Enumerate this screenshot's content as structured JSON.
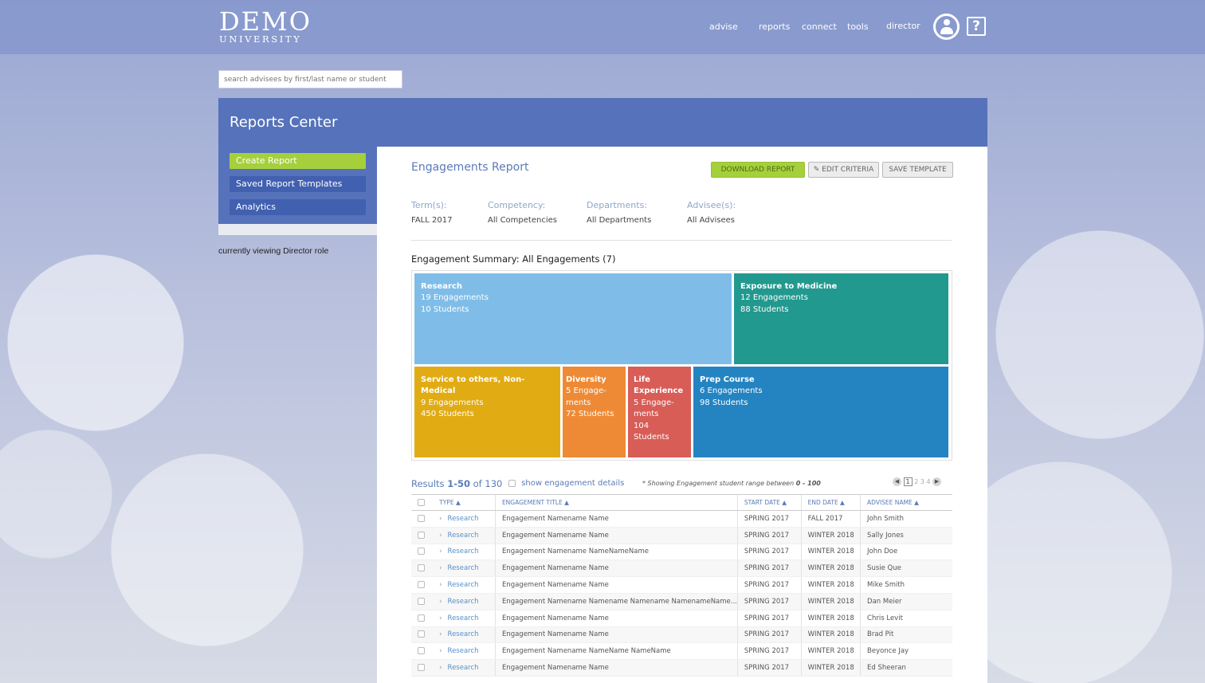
{
  "brand": {
    "name": "DEMO",
    "sub": "UNIVERSITY"
  },
  "nav": {
    "advise": "advise",
    "reports": "reports",
    "connect": "connect",
    "tools": "tools",
    "director": "director"
  },
  "icons": {
    "user": "user-circle-icon",
    "help": "help-icon"
  },
  "help_glyph": "?",
  "search": {
    "placeholder": "search advisees by first/last name or student"
  },
  "header": {
    "title": "Reports Center"
  },
  "sidebar": {
    "items": [
      {
        "label": "Create Report",
        "color": "#a5d03c"
      },
      {
        "label": "Saved Report Templates",
        "color": "#4260b0"
      },
      {
        "label": "Analytics",
        "color": "#4260b0"
      }
    ]
  },
  "role_note": "currently viewing Director role",
  "report": {
    "title": "Engagements Report",
    "buttons": {
      "download": "DOWNLOAD REPORT",
      "edit": "EDIT CRITERIA",
      "save": "SAVE TEMPLATE"
    },
    "criteria": [
      {
        "label": "Term(s):",
        "value": "FALL 2017"
      },
      {
        "label": "Competency:",
        "value": "All Competencies"
      },
      {
        "label": "Departments:",
        "value": "All Departments"
      },
      {
        "label": "Advisee(s):",
        "value": "All Advisees"
      }
    ],
    "summary_title": "Engagement Summary: All Engagements (7)"
  },
  "treemap": [
    {
      "name": "Research",
      "engagements": "19 Engagements",
      "students": "10 Students",
      "color": "#7fbde8"
    },
    {
      "name": "Exposure to Medicine",
      "engagements": "12 Engagements",
      "students": "88 Students",
      "color": "#22998f"
    },
    {
      "name": "Service to others, Non-Medical",
      "engagements": "9 Engagements",
      "students": "450 Students",
      "color": "#e1ab14"
    },
    {
      "name": "Diversity",
      "engagements": "5 Engage-ments",
      "students": "72 Students",
      "color": "#ee8a35"
    },
    {
      "name": "Life Experience",
      "engagements": "5 Engage-ments",
      "students": "104 Students",
      "color": "#d85d57"
    },
    {
      "name": "Prep Course",
      "engagements": "6 Engagements",
      "students": "98 Students",
      "color": "#2484c2"
    }
  ],
  "results": {
    "prefix": "Results ",
    "range": "1-50",
    "of_text": " of ",
    "total": "130",
    "show_details": "show engagement details",
    "range_note": "* Showing Engagement student range between ",
    "range_value": "0 - 100",
    "pager": {
      "prev": "◀",
      "pages": [
        "1",
        "2",
        "3",
        "4"
      ],
      "next": "▶"
    }
  },
  "table": {
    "columns": {
      "type": "TYPE ▲",
      "title": "ENGAGEMENT TITLE ▲",
      "start": "START DATE ▲",
      "end": "END DATE ▲",
      "advisee": "ADVISEE NAME ▲"
    },
    "rows": [
      {
        "type": "Research",
        "title": "Engagement Namename Name",
        "start": "SPRING 2017",
        "end": "FALL 2017",
        "advisee": "John Smith"
      },
      {
        "type": "Research",
        "title": "Engagement Namename Name",
        "start": "SPRING 2017",
        "end": "WINTER 2018",
        "advisee": "Sally Jones"
      },
      {
        "type": "Research",
        "title": "Engagement Namename NameNameName",
        "start": "SPRING 2017",
        "end": "WINTER 2018",
        "advisee": "John Doe"
      },
      {
        "type": "Research",
        "title": "Engagement Namename Name",
        "start": "SPRING 2017",
        "end": "WINTER 2018",
        "advisee": "Susie Que"
      },
      {
        "type": "Research",
        "title": "Engagement Namename Name",
        "start": "SPRING 2017",
        "end": "WINTER 2018",
        "advisee": "Mike Smith"
      },
      {
        "type": "Research",
        "title": "Engagement Namename Namename Namename NamenameName...",
        "start": "SPRING 2017",
        "end": "WINTER 2018",
        "advisee": "Dan Meier"
      },
      {
        "type": "Research",
        "title": "Engagement Namename Name",
        "start": "SPRING 2017",
        "end": "WINTER 2018",
        "advisee": "Chris Levit"
      },
      {
        "type": "Research",
        "title": "Engagement Namename Name",
        "start": "SPRING 2017",
        "end": "WINTER 2018",
        "advisee": "Brad Pit"
      },
      {
        "type": "Research",
        "title": "Engagement Namename NameName NameName",
        "start": "SPRING 2017",
        "end": "WINTER 2018",
        "advisee": "Beyonce Jay"
      },
      {
        "type": "Research",
        "title": "Engagement Namename Name",
        "start": "SPRING 2017",
        "end": "WINTER 2018",
        "advisee": "Ed Sheeran"
      }
    ]
  }
}
